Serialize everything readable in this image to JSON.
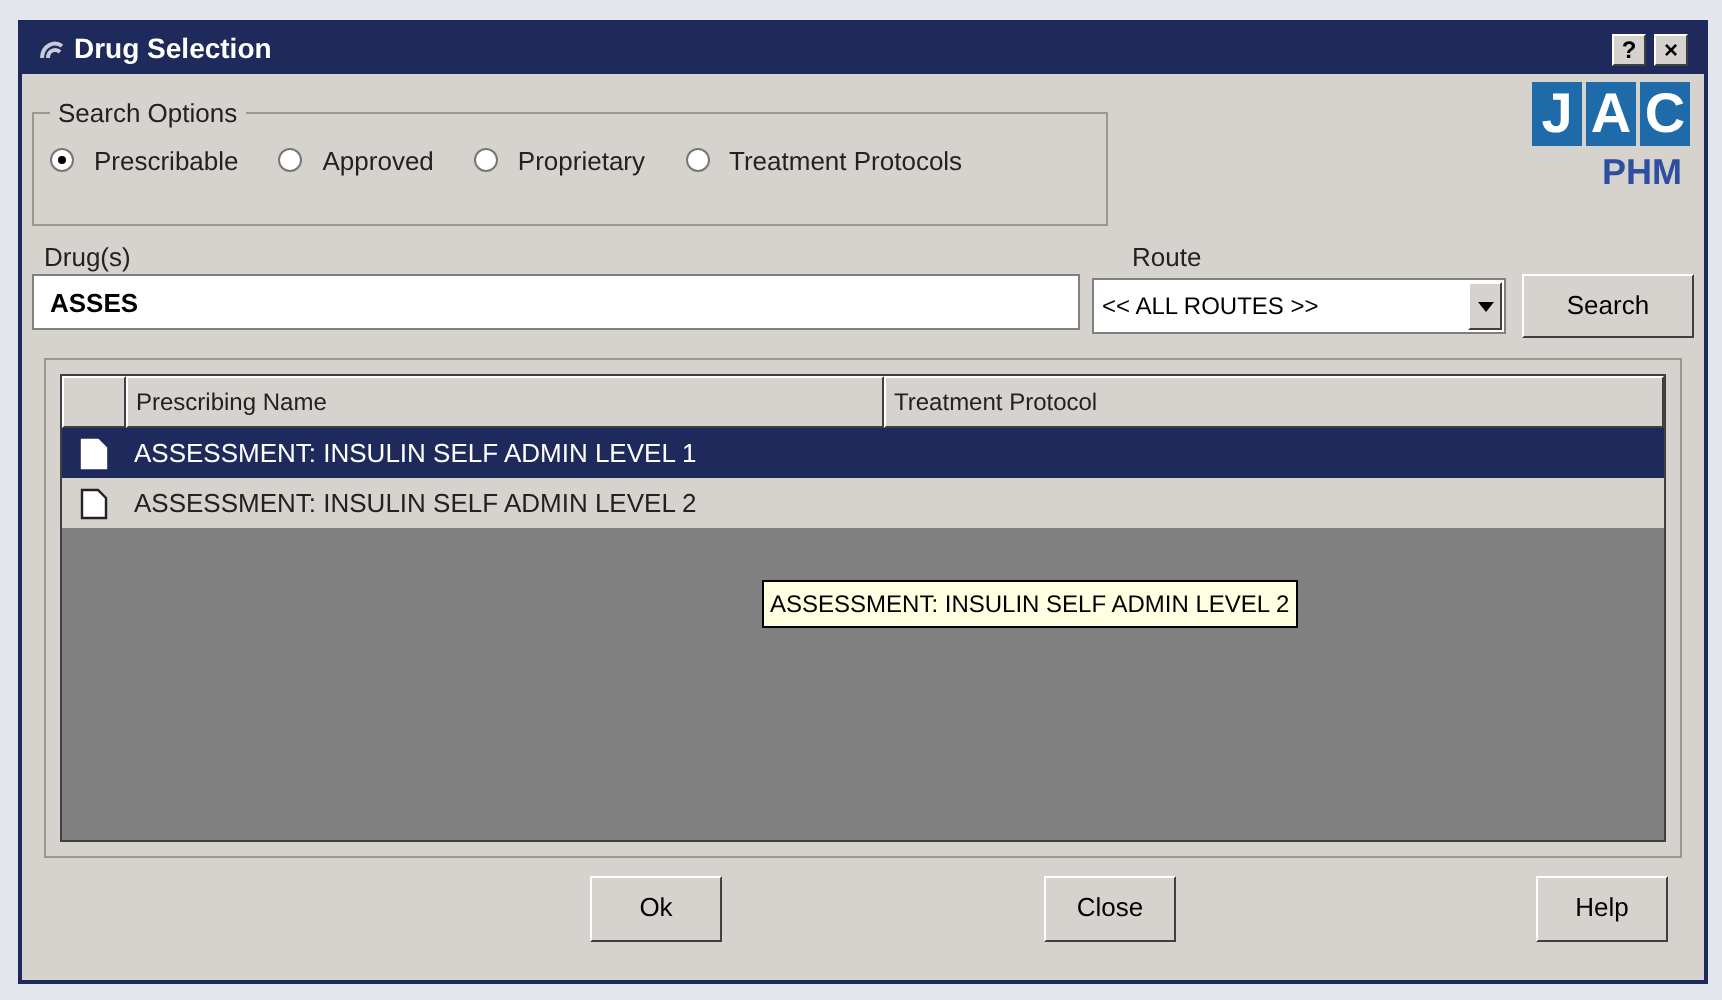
{
  "window": {
    "title": "Drug Selection",
    "buttons": [
      "?",
      "×"
    ]
  },
  "search_options": {
    "label": "Search Options",
    "options": [
      {
        "label": "Prescribable",
        "selected": true
      },
      {
        "label": "Approved",
        "selected": false
      },
      {
        "label": "Proprietary",
        "selected": false
      },
      {
        "label": "Treatment Protocols",
        "selected": false
      }
    ]
  },
  "logo": {
    "letters": [
      "J",
      "A",
      "C"
    ],
    "subtitle": "PHM"
  },
  "drugs": {
    "label": "Drug(s)",
    "value": "ASSES"
  },
  "route": {
    "label": "Route",
    "value": "<< ALL ROUTES >>"
  },
  "search_button": "Search",
  "table": {
    "columns": [
      "Prescribing Name",
      "Treatment Protocol"
    ],
    "rows": [
      {
        "name": "ASSESSMENT: INSULIN SELF ADMIN LEVEL 1",
        "selected": true
      },
      {
        "name": "ASSESSMENT: INSULIN SELF ADMIN LEVEL 2",
        "selected": false
      }
    ]
  },
  "tooltip": "ASSESSMENT: INSULIN SELF ADMIN LEVEL 2",
  "buttons": [
    "Ok",
    "Close",
    "Help"
  ]
}
